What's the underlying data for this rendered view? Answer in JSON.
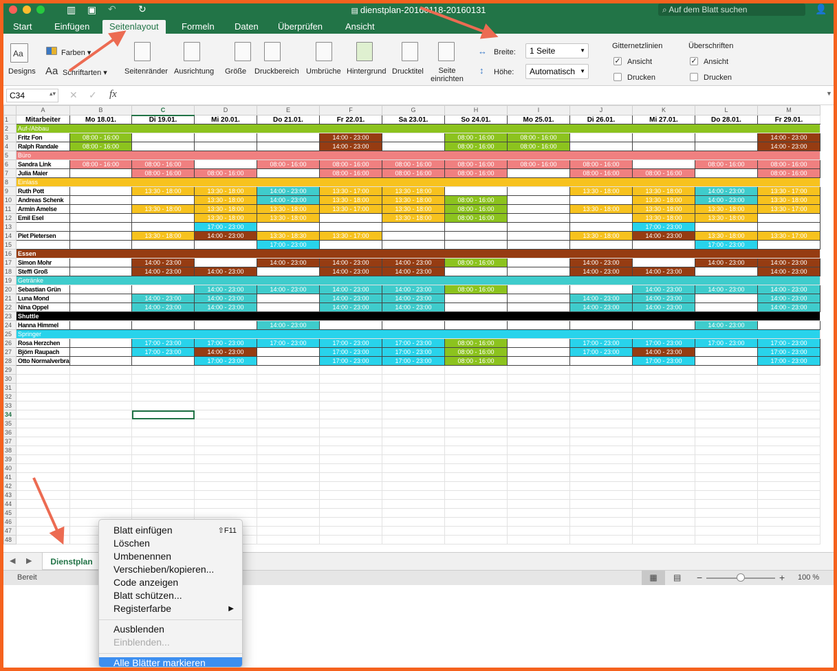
{
  "window": {
    "title": "dienstplan-20160118-20160131",
    "search_placeholder": "Auf dem Blatt suchen"
  },
  "tabs": [
    "Start",
    "Einfügen",
    "Seitenlayout",
    "Formeln",
    "Daten",
    "Überprüfen",
    "Ansicht"
  ],
  "active_tab": "Seitenlayout",
  "ribbon": {
    "designs": "Designs",
    "farben": "Farben",
    "schriftarten": "Schriftarten",
    "buttons": [
      "Seitenränder",
      "Ausrichtung",
      "Größe",
      "Druckbereich",
      "Umbrüche",
      "Hintergrund",
      "Drucktitel",
      "Seite einrichten"
    ],
    "breite_label": "Breite:",
    "breite_value": "1 Seite",
    "hoehe_label": "Höhe:",
    "hoehe_value": "Automatisch",
    "gitternetz_title": "Gitternetzlinien",
    "ueberschriften_title": "Überschriften",
    "ansicht": "Ansicht",
    "drucken": "Drucken"
  },
  "formula_bar": {
    "cell_ref": "C34",
    "formula": ""
  },
  "columns": [
    "A",
    "B",
    "C",
    "D",
    "E",
    "F",
    "G",
    "H",
    "I",
    "J",
    "K",
    "L",
    "M"
  ],
  "header_row": {
    "name": "Mitarbeiter",
    "days": [
      "Mo 18.01.",
      "Di 19.01.",
      "Mi 20.01.",
      "Do 21.01.",
      "Fr 22.01.",
      "Sa 23.01.",
      "So 24.01.",
      "Mo 25.01.",
      "Di 26.01.",
      "Mi 27.01.",
      "Do 28.01.",
      "Fr 29.01."
    ]
  },
  "colors": {
    "green": "#8cc31e",
    "red": "#f08080",
    "yellow": "#f7c21e",
    "teal": "#3fcccc",
    "brown": "#963c12",
    "black": "#000000",
    "cyan": "#28d3eb",
    "accent": "#227447"
  },
  "rows": [
    {
      "n": 2,
      "cat": "Auf-/Abbau",
      "color": "green"
    },
    {
      "n": 3,
      "name": "Fritz Fon",
      "cells": [
        "08:00 - 16:00",
        "",
        "",
        "",
        "14:00 - 23:00",
        "",
        "08:00 - 16:00",
        "08:00 - 16:00",
        "",
        "",
        "",
        "14:00 - 23:00"
      ],
      "color": "green",
      "spec": {
        "4": "brown",
        "11": "brown"
      }
    },
    {
      "n": 4,
      "name": "Ralph Randale",
      "cells": [
        "08:00 - 16:00",
        "",
        "",
        "",
        "14:00 - 23:00",
        "",
        "08:00 - 16:00",
        "08:00 - 16:00",
        "",
        "",
        "",
        "14:00 - 23:00"
      ],
      "color": "green",
      "spec": {
        "4": "brown",
        "11": "brown"
      }
    },
    {
      "n": 5,
      "cat": "Büro",
      "color": "red"
    },
    {
      "n": 6,
      "name": "Sandra Link",
      "cells": [
        "08:00 - 16:00",
        "08:00 - 16:00",
        "",
        "08:00 - 16:00",
        "08:00 - 16:00",
        "08:00 - 16:00",
        "08:00 - 16:00",
        "08:00 - 16:00",
        "08:00 - 16:00",
        "",
        "08:00 - 16:00",
        "08:00 - 16:00"
      ],
      "color": "red"
    },
    {
      "n": 7,
      "name": "Julia Maier",
      "cells": [
        "",
        "08:00 - 16:00",
        "08:00 - 16:00",
        "",
        "08:00 - 16:00",
        "08:00 - 16:00",
        "08:00 - 16:00",
        "",
        "08:00 - 16:00",
        "08:00 - 16:00",
        "",
        "08:00 - 16:00"
      ],
      "color": "red"
    },
    {
      "n": 8,
      "cat": "Einlass",
      "color": "yellow"
    },
    {
      "n": 9,
      "name": "Ruth Pott",
      "cells": [
        "",
        "13:30 - 18:00",
        "13:30 - 18:00",
        "14:00 - 23:00",
        "13:30 - 17:00",
        "13:30 - 18:00",
        "",
        "",
        "13:30 - 18:00",
        "13:30 - 18:00",
        "14:00 - 23:00",
        "13:30 - 17:00"
      ],
      "color": "yellow",
      "spec": {
        "3": "teal",
        "10": "teal"
      }
    },
    {
      "n": 10,
      "name": "Andreas Schenk",
      "cells": [
        "",
        "",
        "13:30 - 18:00",
        "14:00 - 23:00",
        "13:30 - 18:00",
        "13:30 - 18:00",
        "08:00 - 16:00",
        "",
        "",
        "13:30 - 18:00",
        "14:00 - 23:00",
        "13:30 - 18:00"
      ],
      "color": "yellow",
      "spec": {
        "3": "teal",
        "6": "green",
        "10": "teal"
      }
    },
    {
      "n": 11,
      "name": "Armin Amelse",
      "cells": [
        "",
        "13:30 - 18:00",
        "13:30 - 18:00",
        "13:30 - 18:00",
        "13:30 - 17:00",
        "13:30 - 18:00",
        "08:00 - 16:00",
        "",
        "13:30 - 18:00",
        "13:30 - 18:00",
        "13:30 - 18:00",
        "13:30 - 17:00"
      ],
      "color": "yellow",
      "spec": {
        "6": "green"
      }
    },
    {
      "n": 12,
      "name": "Emil Esel",
      "cells": [
        "",
        "",
        "13:30 - 18:00",
        "13:30 - 18:00",
        "",
        "13:30 - 18:00",
        "08:00 - 16:00",
        "",
        "",
        "13:30 - 18:00",
        "13:30 - 18:00",
        ""
      ],
      "color": "yellow",
      "spec": {
        "6": "green"
      }
    },
    {
      "n": 13,
      "name": "",
      "cells": [
        "",
        "",
        "17:00 - 23:00",
        "",
        "",
        "",
        "",
        "",
        "",
        "17:00 - 23:00",
        "",
        ""
      ],
      "color": "cyan"
    },
    {
      "n": 14,
      "name": "Piet Pietersen",
      "cells": [
        "",
        "13:30 - 18:00",
        "14:00 - 23:00",
        "13:30 - 18:30",
        "13:30 - 17:00",
        "",
        "",
        "",
        "13:30 - 18:00",
        "14:00 - 23:00",
        "13:30 - 18:00",
        "13:30 - 17:00"
      ],
      "color": "yellow",
      "spec": {
        "2": "brown",
        "9": "brown"
      }
    },
    {
      "n": 15,
      "name": "",
      "cells": [
        "",
        "",
        "",
        "17:00 - 23:00",
        "",
        "",
        "",
        "",
        "",
        "",
        "17:00 - 23:00",
        ""
      ],
      "color": "cyan"
    },
    {
      "n": 16,
      "cat": "Essen",
      "color": "brown"
    },
    {
      "n": 17,
      "name": "Simon Mohr",
      "cells": [
        "",
        "14:00 - 23:00",
        "",
        "14:00 - 23:00",
        "14:00 - 23:00",
        "14:00 - 23:00",
        "08:00 - 16:00",
        "",
        "14:00 - 23:00",
        "",
        "14:00 - 23:00",
        "14:00 - 23:00"
      ],
      "color": "brown",
      "spec": {
        "6": "green"
      }
    },
    {
      "n": 18,
      "name": "Steffi Groß",
      "cells": [
        "",
        "14:00 - 23:00",
        "14:00 - 23:00",
        "",
        "14:00 - 23:00",
        "14:00 - 23:00",
        "",
        "",
        "14:00 - 23:00",
        "14:00 - 23:00",
        "",
        "14:00 - 23:00"
      ],
      "color": "brown"
    },
    {
      "n": 19,
      "cat": "Getränke",
      "color": "teal"
    },
    {
      "n": 20,
      "name": "Sebastian Grün",
      "cells": [
        "",
        "",
        "14:00 - 23:00",
        "14:00 - 23:00",
        "14:00 - 23:00",
        "14:00 - 23:00",
        "08:00 - 16:00",
        "",
        "",
        "14:00 - 23:00",
        "14:00 - 23:00",
        "14:00 - 23:00"
      ],
      "color": "teal",
      "spec": {
        "6": "green"
      }
    },
    {
      "n": 21,
      "name": "Luna Mond",
      "cells": [
        "",
        "14:00 - 23:00",
        "14:00 - 23:00",
        "",
        "14:00 - 23:00",
        "14:00 - 23:00",
        "",
        "",
        "14:00 - 23:00",
        "14:00 - 23:00",
        "",
        "14:00 - 23:00"
      ],
      "color": "teal"
    },
    {
      "n": 22,
      "name": "Nina Oppel",
      "cells": [
        "",
        "14:00 - 23:00",
        "14:00 - 23:00",
        "",
        "14:00 - 23:00",
        "14:00 - 23:00",
        "",
        "",
        "14:00 - 23:00",
        "14:00 - 23:00",
        "",
        "14:00 - 23:00"
      ],
      "color": "teal"
    },
    {
      "n": 23,
      "cat": "Shuttle",
      "color": "black"
    },
    {
      "n": 24,
      "name": "Hanna Himmel",
      "cells": [
        "",
        "",
        "",
        "14:00 - 23:00",
        "",
        "",
        "",
        "",
        "",
        "",
        "14:00 - 23:00",
        ""
      ],
      "color": "teal"
    },
    {
      "n": 25,
      "cat": "Springer",
      "color": "cyan"
    },
    {
      "n": 26,
      "name": "Rosa Herzchen",
      "cells": [
        "",
        "17:00 - 23:00",
        "17:00 - 23:00",
        "17:00 - 23:00",
        "17:00 - 23:00",
        "17:00 - 23:00",
        "08:00 - 16:00",
        "",
        "17:00 - 23:00",
        "17:00 - 23:00",
        "17:00 - 23:00",
        "17:00 - 23:00"
      ],
      "color": "cyan",
      "spec": {
        "6": "green"
      }
    },
    {
      "n": 27,
      "name": "Björn Raupach",
      "cells": [
        "",
        "17:00 - 23:00",
        "14:00 - 23:00",
        "",
        "17:00 - 23:00",
        "17:00 - 23:00",
        "08:00 - 16:00",
        "",
        "17:00 - 23:00",
        "14:00 - 23:00",
        "",
        "17:00 - 23:00"
      ],
      "color": "cyan",
      "spec": {
        "2": "brown",
        "6": "green",
        "9": "brown"
      }
    },
    {
      "n": 28,
      "name": "Otto Normalverbraucher",
      "cells": [
        "",
        "",
        "17:00 - 23:00",
        "",
        "17:00 - 23:00",
        "17:00 - 23:00",
        "08:00 - 16:00",
        "",
        "",
        "17:00 - 23:00",
        "",
        "17:00 - 23:00"
      ],
      "color": "cyan",
      "spec": {
        "6": "green"
      }
    }
  ],
  "empty_rows_from": 29,
  "empty_rows_to": 48,
  "selected_row": 34,
  "selected_col": "C",
  "sheet_tab": "Dienstplan",
  "status": {
    "mode": "Bereit",
    "zoom": "100 %",
    "zoom_level": 0.5
  },
  "context_menu": [
    {
      "label": "Blatt einfügen",
      "shortcut": "⇧F11"
    },
    {
      "label": "Löschen"
    },
    {
      "label": "Umbenennen"
    },
    {
      "label": "Verschieben/kopieren..."
    },
    {
      "label": "Code anzeigen"
    },
    {
      "label": "Blatt schützen..."
    },
    {
      "label": "Registerfarbe",
      "submenu": "▶"
    },
    {
      "sep": true
    },
    {
      "label": "Ausblenden"
    },
    {
      "label": "Einblenden...",
      "disabled": true
    },
    {
      "sep": true
    },
    {
      "label": "Alle Blätter markieren",
      "highlighted": true
    }
  ]
}
